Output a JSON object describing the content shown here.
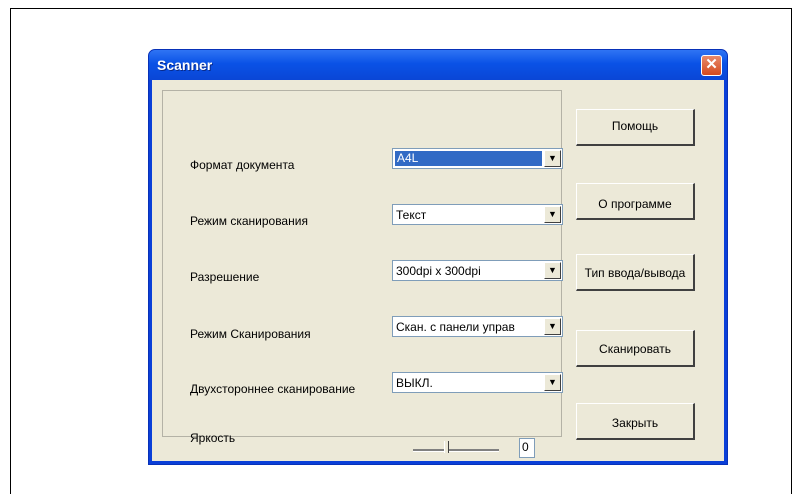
{
  "window": {
    "title": "Scanner"
  },
  "form": {
    "doc_format": {
      "label": "Формат документа",
      "value": "A4L"
    },
    "scan_mode": {
      "label": "Режим сканирования",
      "value": "Текст"
    },
    "resolution": {
      "label": "Разрешение",
      "value": "300dpi x 300dpi"
    },
    "scan_source": {
      "label": "Режим Сканирования",
      "value": "Скан. с панели управ"
    },
    "duplex": {
      "label": "Двухстороннее сканирование",
      "value": "ВЫКЛ."
    },
    "brightness": {
      "label": "Яркость",
      "value": "0"
    }
  },
  "buttons": {
    "help": "Помощь",
    "about": "О программе",
    "io_type": "Тип ввода/вывода",
    "scan": "Сканировать",
    "close": "Закрыть"
  },
  "icons": {
    "close": "close-icon",
    "dropdown": "chevron-down-icon"
  }
}
